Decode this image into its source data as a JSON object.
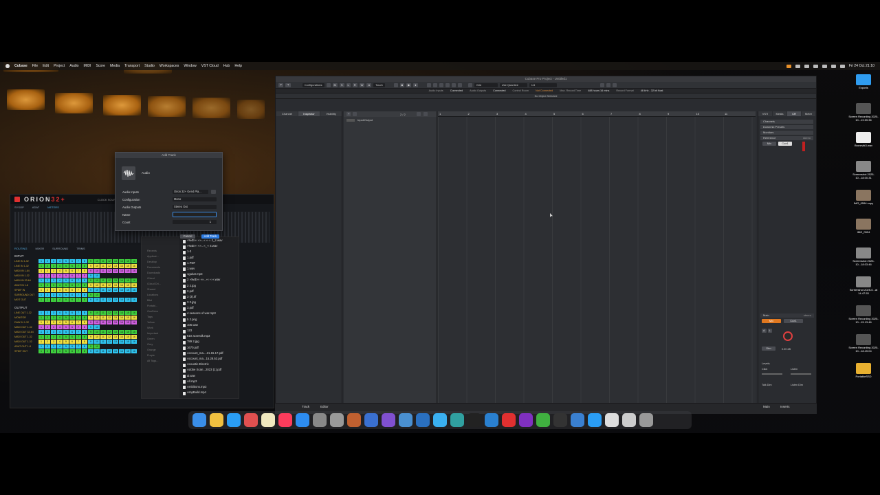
{
  "menubar": {
    "app": "Cubase",
    "items": [
      "File",
      "Edit",
      "Project",
      "Audio",
      "MIDI",
      "Score",
      "Media",
      "Transport",
      "Studio",
      "Workspaces",
      "Window",
      "VST Cloud",
      "Hub",
      "Help"
    ],
    "clock": "Fri 24 Oct 21:10"
  },
  "cubase": {
    "title": "Cubase Pro Project - Untitled1",
    "toolbar": {
      "configurations": "Configurations",
      "touch": "Touch",
      "grid": "Grid",
      "use_quantize": "Use Quantize",
      "quantize_value": "1/4"
    },
    "status": {
      "audio_inputs": "Audio Inputs",
      "connected1": "Connected",
      "audio_outputs": "Audio Outputs",
      "connected2": "Connected",
      "control_room": "Control Room",
      "not_connected": "Not Connected",
      "max_record_time_label": "Max. Record Time",
      "max_record_time": "488 hours 16 mins",
      "record_format_label": "Record Format",
      "record_format": "48 kHz - 32 bit float"
    },
    "info_line": "No Object Selected",
    "inspector_tabs": [
      "Channel",
      "Inspector",
      "Visibility"
    ],
    "track_count": "2 / 2",
    "track_folder": "Input/Output",
    "ruler": [
      "1",
      "2",
      "3",
      "4",
      "5",
      "6",
      "7",
      "8",
      "9",
      "10",
      "11"
    ],
    "right_tabs": [
      "VSTi",
      "Media",
      "CR",
      "Meter"
    ],
    "right_rows": [
      "Channels",
      "Downmix Presets",
      "Monitors",
      "Reference"
    ],
    "reference_value": "stereo",
    "mix_btn": "Mix",
    "cue_btn": "Cue1",
    "main_label": "Main",
    "main_value": "stereo",
    "dim_label": "Dim",
    "level_value": "0.00 dB",
    "levels_label": "Levels",
    "click_label": "Click",
    "listen_label": "Listen",
    "talkdim_label": "Talk Dim",
    "listendim_label": "Listen Dim",
    "bottom_tabs": [
      "Track",
      "Editor"
    ],
    "bottom_right_tabs": [
      "Main",
      "Inserts"
    ]
  },
  "dialog": {
    "title": "Add Track",
    "type_label": "Audio",
    "audio_inputs_label": "Audio Inputs",
    "audio_inputs_value": "Orion 32+ Gen4 Pla...",
    "configuration_label": "Configuration",
    "configuration_value": "Mono",
    "audio_outputs_label": "Audio Outputs",
    "audio_outputs_value": "Stereo Out",
    "name_label": "Name",
    "name_value": "",
    "count_label": "Count",
    "count_value": "1",
    "cancel": "Cancel",
    "add_track": "Add Track"
  },
  "orion": {
    "logo_main": "ORION",
    "logo_suffix": "32+",
    "clock_source": "CLOCK SOURCE",
    "tabs": [
      "SYSOP",
      "ADAT",
      "METERS"
    ],
    "routing_tabs": [
      "ROUTING",
      "MIXER",
      "SURROUND",
      "TRIMS"
    ],
    "input_label": "INPUT",
    "output_label": "OUTPUT",
    "input_rows": [
      "LINE IN 1-32",
      "LINE IN 1-32",
      "MADI IN 1-64",
      "MADI IN 1-32",
      "MADI IN 33-64",
      "ADAT IN 1-8",
      "SPDIF IN",
      "SURROUND OUT",
      "MIXT OUT"
    ],
    "output_rows": [
      "LINE OUT 1-32",
      "MONITOR",
      "DAW IN 1-32",
      "MADI OUT 1-32",
      "MADI OUT 33-64",
      "MADI OUT 1-32",
      "MADI OUT 1-32",
      "ADAT OUT 1-8",
      "SPDIF OUT"
    ]
  },
  "finder": {
    "sidebar": [
      "Recents",
      "Applicat...",
      "Desktop",
      "Documents",
      "Downloads",
      "iCloud",
      "iCloud Dri...",
      "Shared",
      "Locations",
      "Bilal",
      "Portabl...",
      "OneDrive",
      "Tags",
      "Yellow",
      "Work",
      "Important",
      "Green",
      "Grey",
      "Orange",
      "Purple",
      "All Tags..."
    ],
    "files": [
      "»‰Œ«‹ «»...« « ‹‹ 2_2.wav",
      "»‰Œ«‹ «»...«_‹‹ 4.wav",
      "1-3",
      "1.pdf",
      "1.PDF",
      "1.wav",
      "1guitar.mp3",
      "2 »‰Œ«‹ «»...‹« ‹‹ «.wav",
      "2 2.jpg",
      "2.pdf",
      "3 (3).tif",
      "3 2.jpg",
      "3.pdf",
      "4 seasons of war.mp3",
      "5 2.png",
      "105.wav",
      "123",
      "610 acvestik.mp3",
      "789 2.jpg",
      "1670.pdf",
      "Account_ma....21.15.17.pdf",
      "Account_ma...15.28.53.pdf",
      "Acoustic-Electric",
      "Adobe Scan...2023 (1).pdf",
      "ai.wav",
      "All.mp3",
      "Ambitions.mp3",
      "AmpBuild.mp4"
    ]
  },
  "desktop_icons": [
    {
      "label": "Exports",
      "color": "#2f9cf0"
    },
    {
      "label": "Screen Recording 2025-10...19.59.36",
      "color": "#555"
    },
    {
      "label": "Bronevik3.wav",
      "color": "#eee"
    },
    {
      "label": "Screenshot 2025-10...18.00.31",
      "color": "#888"
    },
    {
      "label": "IMG_0594 copy",
      "color": "#8a7560"
    },
    {
      "label": "IMG_0594",
      "color": "#8a7560"
    },
    {
      "label": "Screenshot 2025-10...18.03.46",
      "color": "#888"
    },
    {
      "label": "Screenshot 2025-0...at 14.47.53",
      "color": "#888"
    },
    {
      "label": "Screen Recording 2025-10...15.13.46",
      "color": "#555"
    },
    {
      "label": "Screen Recording 2025-10...18.49.04",
      "color": "#555"
    },
    {
      "label": "PortableSSD",
      "color": "#e8b030"
    }
  ],
  "dock_colors": [
    "#3a8ee8",
    "#f0c040",
    "#2a9df4",
    "#e05050",
    "#f0e8c0",
    "#fc3c5c",
    "#2d8cf0",
    "#888",
    "#999",
    "#c06030",
    "#3a70d0",
    "#8050d0",
    "#4a90d0",
    "#2a70c0",
    "#3ab0f0",
    "#30a0a0",
    "#222",
    "#2a80d0",
    "#e03030",
    "#8030c0",
    "#40b040",
    "#333",
    "#3a80d0",
    "#2a9df4",
    "#ddd",
    "#ccc",
    "#999"
  ]
}
